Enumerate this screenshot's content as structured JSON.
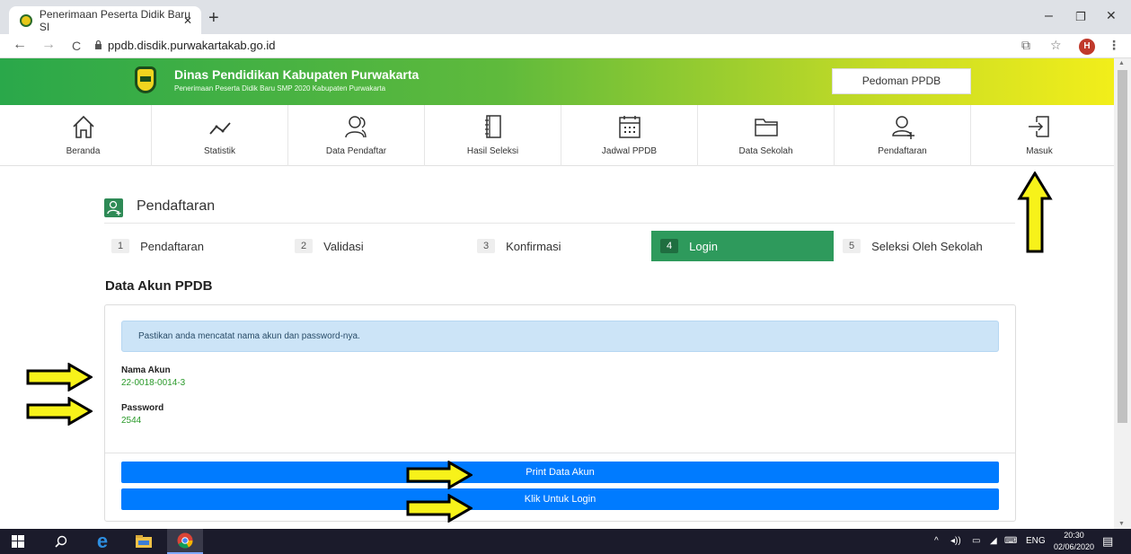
{
  "browser": {
    "tab_title": "Penerimaan Peserta Didik Baru SI",
    "tab_close": "✕",
    "new_tab": "+",
    "url": "ppdb.disdik.purwakartakab.go.id",
    "minimize": "–",
    "maximize": "❐",
    "close": "✕",
    "back": "←",
    "forward": "→",
    "reload": "C",
    "profile_initial": "H"
  },
  "header": {
    "title": "Dinas Pendidikan Kabupaten Purwakarta",
    "subtitle": "Penerimaan Peserta Didik Baru SMP 2020 Kabupaten Purwakarta",
    "guide_button": "Pedoman PPDB"
  },
  "menu": {
    "items": [
      {
        "label": "Beranda",
        "icon": "home-icon"
      },
      {
        "label": "Statistik",
        "icon": "chart-line-icon"
      },
      {
        "label": "Data Pendaftar",
        "icon": "users-icon"
      },
      {
        "label": "Hasil Seleksi",
        "icon": "book-icon"
      },
      {
        "label": "Jadwal PPDB",
        "icon": "calendar-icon"
      },
      {
        "label": "Data Sekolah",
        "icon": "folder-icon"
      },
      {
        "label": "Pendaftaran",
        "icon": "user-add-icon"
      },
      {
        "label": "Masuk",
        "icon": "login-icon"
      }
    ]
  },
  "section": {
    "title": "Pendaftaran"
  },
  "steps": [
    {
      "num": "1",
      "label": "Pendaftaran"
    },
    {
      "num": "2",
      "label": "Validasi"
    },
    {
      "num": "3",
      "label": "Konfirmasi"
    },
    {
      "num": "4",
      "label": "Login"
    },
    {
      "num": "5",
      "label": "Seleksi Oleh Sekolah"
    }
  ],
  "account": {
    "heading": "Data Akun PPDB",
    "alert": "Pastikan anda mencatat nama akun dan password-nya.",
    "name_label": "Nama Akun",
    "name_value": "22-0018-0014-3",
    "password_label": "Password",
    "password_value": "2544",
    "print_button": "Print Data Akun",
    "login_button": "Klik Untuk Login"
  },
  "taskbar": {
    "time": "20:30",
    "date": "02/06/2020",
    "lang": "ENG"
  },
  "colors": {
    "active_step": "#2e9a5c",
    "button_blue": "#007bff",
    "value_green": "#2b9a2b",
    "arrow_fill": "#f7f21a"
  }
}
